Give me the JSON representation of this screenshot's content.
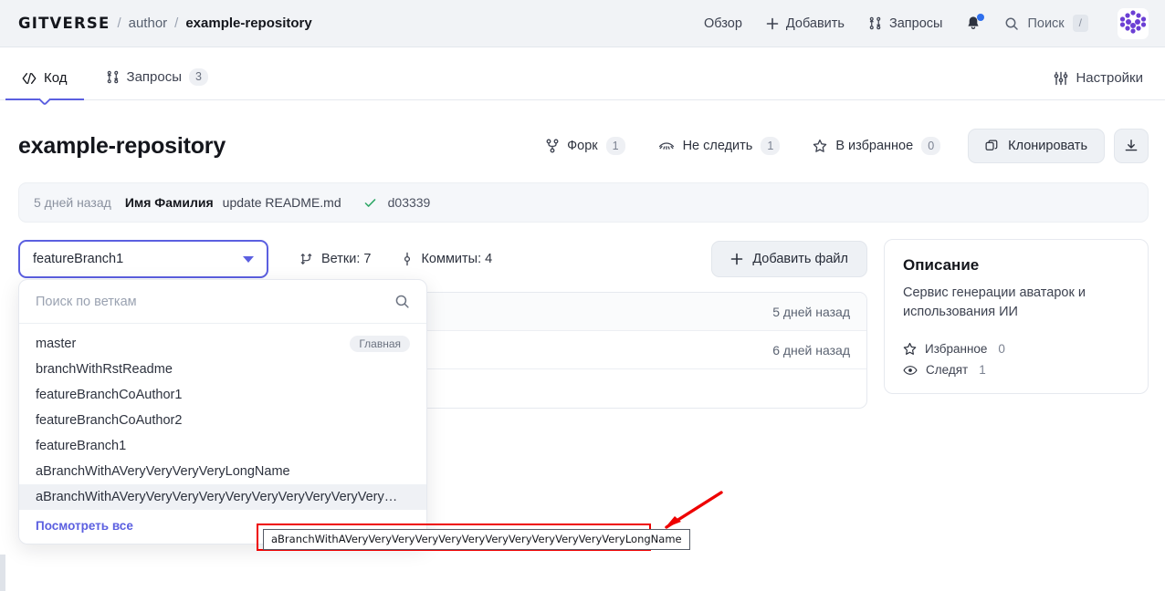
{
  "header": {
    "brand": "GITVERSE",
    "separator": "/",
    "owner": "author",
    "repo": "example-repository",
    "nav": [
      {
        "label": "Обзор",
        "icon": ""
      },
      {
        "label": "Добавить",
        "icon": "plus-icon"
      },
      {
        "label": "Запросы",
        "icon": "pull-request-icon"
      }
    ],
    "notifications_icon": "bell-icon",
    "search_label": "Поиск",
    "search_key": "/",
    "avatar_icon": "user-avatar-logo"
  },
  "tabs": {
    "items": [
      {
        "label": "Код",
        "icon": "code-icon",
        "badge": "",
        "active": true
      },
      {
        "label": "Запросы",
        "icon": "pull-request-icon",
        "badge": "3",
        "active": false
      }
    ],
    "settings": {
      "label": "Настройки",
      "icon": "sliders-icon"
    }
  },
  "repo": {
    "title": "example-repository",
    "actions": [
      {
        "label": "Форк",
        "count": "1",
        "icon": "fork-icon"
      },
      {
        "label": "Не следить",
        "count": "1",
        "icon": "eye-off-icon"
      },
      {
        "label": "В избранное",
        "count": "0",
        "icon": "star-icon"
      }
    ],
    "clone_label": "Клонировать",
    "clone_icon": "copy-icon",
    "download_icon": "download-icon"
  },
  "commit": {
    "time": "5 дней назад",
    "author": "Имя Фамилия",
    "message": "update README.md",
    "status_icon": "check-icon",
    "hash": "d03339"
  },
  "branch_bar": {
    "current_branch": "featureBranch1",
    "chevron_icon": "chevron-down-icon",
    "branches_label": "Ветки: 7",
    "branches_icon": "branch-icon",
    "commits_label": "Коммиты: 4",
    "commits_icon": "commit-icon",
    "add_file_label": "Добавить файл",
    "add_file_icon": "plus-icon"
  },
  "dropdown": {
    "search_placeholder": "Поиск по веткам",
    "search_value": "",
    "search_icon": "search-icon",
    "items": [
      {
        "name": "master",
        "badge": "Главная",
        "hover": false
      },
      {
        "name": "branchWithRstReadme",
        "badge": "",
        "hover": false
      },
      {
        "name": "featureBranchCoAuthor1",
        "badge": "",
        "hover": false
      },
      {
        "name": "featureBranchCoAuthor2",
        "badge": "",
        "hover": false
      },
      {
        "name": "featureBranch1",
        "badge": "",
        "hover": false
      },
      {
        "name": "aBranchWithAVeryVeryVeryVeryLongName",
        "badge": "",
        "hover": false
      },
      {
        "name": "aBranchWithAVeryVeryVeryVeryVeryVeryVeryVeryVeryVeryVeryVeryLongName",
        "badge": "",
        "hover": true
      }
    ],
    "view_all_label": "Посмотреть все"
  },
  "tooltip": {
    "text": "aBranchWithAVeryVeryVeryVeryVeryVeryVeryVeryVeryVeryVeryVeryLongName"
  },
  "files": {
    "rows": [
      {
        "name": "",
        "time": "5 дней назад"
      },
      {
        "name": "",
        "time": "6 дней назад"
      },
      {
        "name": "",
        "time": ""
      }
    ]
  },
  "sidebar": {
    "title": "Описание",
    "description": "Сервис генерации аватарок и использования ИИ",
    "stats": [
      {
        "icon": "star-icon",
        "label": "Избранное",
        "value": "0"
      },
      {
        "icon": "eye-icon",
        "label": "Следят",
        "value": "1"
      }
    ]
  },
  "colors": {
    "accent": "#5b5fe0",
    "annotation": "#ee0000",
    "header_bg": "#f1f3f6",
    "success": "#2ea766",
    "notification_dot": "#2f6fed"
  }
}
